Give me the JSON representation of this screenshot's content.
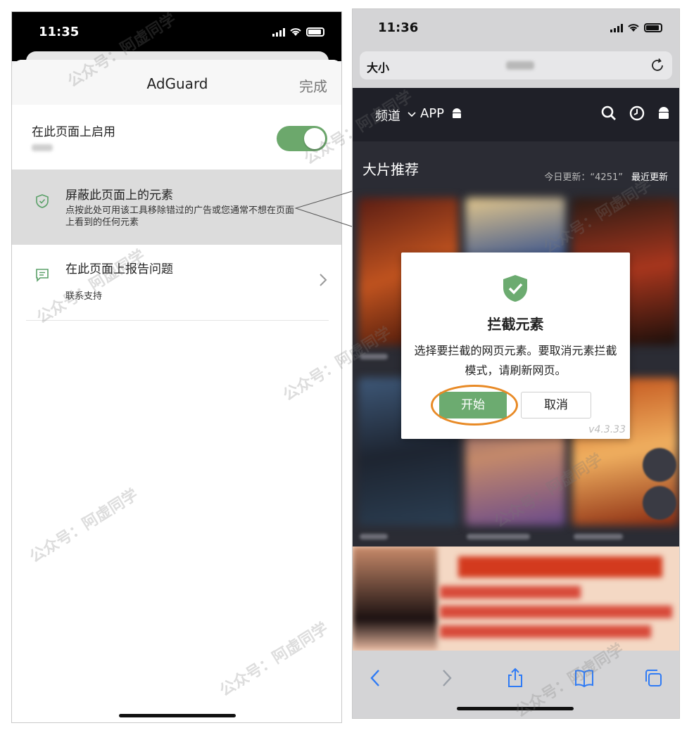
{
  "left_phone": {
    "status_time": "11:35",
    "sheet": {
      "title": "AdGuard",
      "done_label": "完成",
      "enable_label": "在此页面上启用",
      "toggle_on": true,
      "toggle_color": "#6ca86c"
    },
    "block_element": {
      "title": "屏蔽此页面上的元素",
      "description": "点按此处可用该工具移除错过的广告或您通常不想在页面上看到的任何元素"
    },
    "report": {
      "title": "在此页面上报告问题",
      "subtitle": "联系支持"
    },
    "icons": [
      "shield-check-icon",
      "chat-icon",
      "chevron-right-icon"
    ]
  },
  "right_phone": {
    "status_time": "11:36",
    "url_bar": {
      "text_size_label": "大小"
    },
    "site": {
      "nav_channel": "频道",
      "nav_app": "APP",
      "section_title": "大片推荐",
      "update_text": "今日更新：“4251”",
      "latest_label": "最近更新"
    },
    "dialog": {
      "title": "拦截元素",
      "message": "选择要拦截的网页元素。要取消元素拦截模式，请刷新网页。",
      "start_label": "开始",
      "cancel_label": "取消",
      "version": "v4.3.33",
      "accent_color": "#6cab70",
      "highlight_color": "#e88a26"
    }
  },
  "watermark": "公众号：阿虚同学"
}
